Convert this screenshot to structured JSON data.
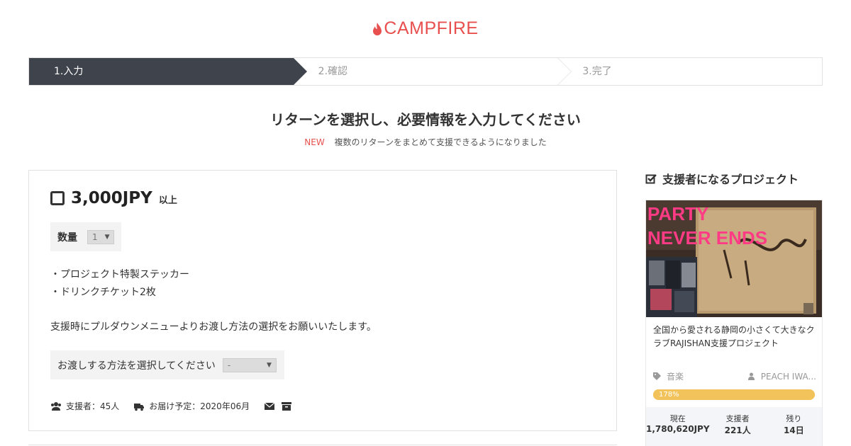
{
  "brand": {
    "name": "CAMPFIRE",
    "color": "#e8504f"
  },
  "steps": [
    {
      "label": "1.入力",
      "active": true
    },
    {
      "label": "2.確認",
      "active": false
    },
    {
      "label": "3.完了",
      "active": false
    }
  ],
  "heading": "リターンを選択し、必要情報を入力してください",
  "notice": {
    "badge": "NEW",
    "text": "複数のリターンをまとめて支援できるようになりました"
  },
  "reward": {
    "price": "3,000JPY",
    "price_suffix": "以上",
    "checked": false,
    "quantity_label": "数量",
    "quantity_value": "1",
    "items": [
      "・プロジェクト特製ステッカー",
      "・ドリンクチケット2枚"
    ],
    "instruction": "支援時にプルダウンメニューよりお渡し方法の選択をお願いいたします。",
    "delivery_label": "お渡しする方法を選択してください",
    "delivery_value": "-",
    "backers": "支援者：45人",
    "delivery_schedule": "お届け予定：2020年06月"
  },
  "sidebar": {
    "title": "支援者になるプロジェクト",
    "project": {
      "image_text_line1": "PARTY",
      "image_text_line2": "NEVER ENDS",
      "title": "全国から愛される静岡の小さくて大きなクラブRAJISHAN支援プロジェクト",
      "category": "音楽",
      "owner": "PEACH IWA...",
      "progress_label": "178%",
      "progress_percent": 178,
      "stats": [
        {
          "label": "現在",
          "value": "1,780,620JPY"
        },
        {
          "label": "支援者",
          "value": "221人"
        },
        {
          "label": "残り",
          "value": "14日"
        }
      ]
    }
  }
}
